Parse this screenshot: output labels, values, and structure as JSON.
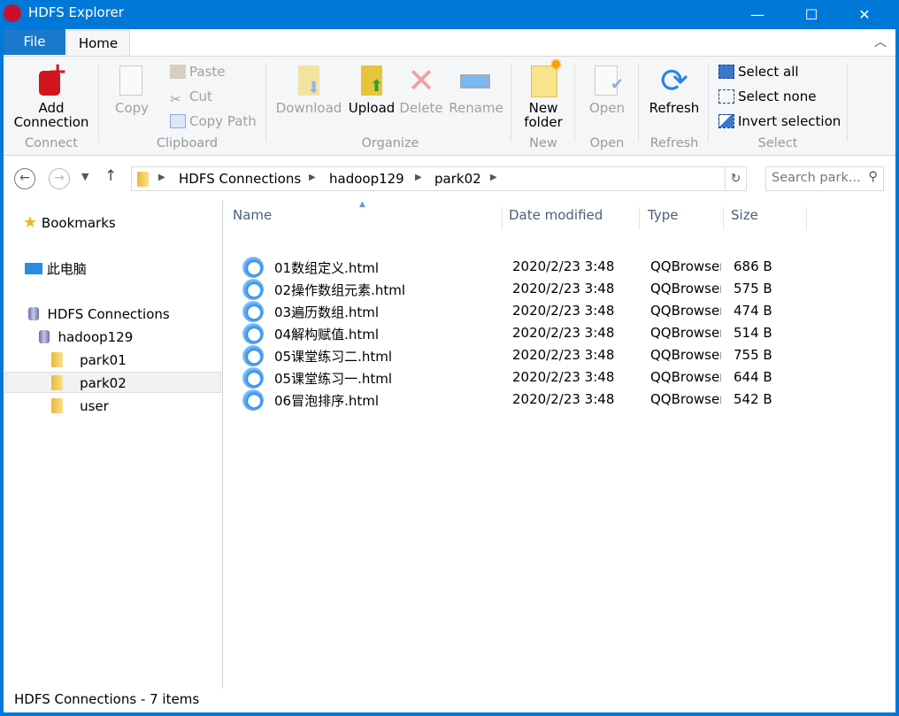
{
  "window": {
    "title": "HDFS Explorer",
    "minimize": "—",
    "maximize": "☐",
    "close": "✕"
  },
  "ribbon": {
    "tabs": {
      "file": "File",
      "home": "Home"
    },
    "connect": {
      "add_connection_1": "Add",
      "add_connection_2": "Connection",
      "label": "Connect"
    },
    "clipboard": {
      "copy": "Copy",
      "paste": "Paste",
      "cut": "Cut",
      "copy_path": "Copy Path",
      "label": "Clipboard"
    },
    "organize": {
      "download": "Download",
      "upload": "Upload",
      "delete": "Delete",
      "rename": "Rename",
      "label": "Organize"
    },
    "new": {
      "new_folder_1": "New",
      "new_folder_2": "folder",
      "label": "New"
    },
    "open": {
      "open": "Open",
      "label": "Open"
    },
    "refresh": {
      "refresh": "Refresh",
      "label": "Refresh"
    },
    "select": {
      "select_all": "Select all",
      "select_none": "Select none",
      "invert": "Invert selection",
      "label": "Select"
    }
  },
  "address": {
    "crumbs": [
      "HDFS Connections",
      "hadoop129",
      "park02"
    ],
    "search_placeholder": "Search park..."
  },
  "sidebar": {
    "bookmarks": "Bookmarks",
    "this_pc": "此电脑",
    "hdfs": "HDFS Connections",
    "host": "hadoop129",
    "folders": [
      "park01",
      "park02",
      "user"
    ],
    "selected": "park02"
  },
  "files": {
    "columns": [
      "Name",
      "Date modified",
      "Type",
      "Size"
    ],
    "rows": [
      {
        "name": "01数组定义.html",
        "date": "2020/2/23 3:48",
        "type": "QQBrowser",
        "size": "686 B"
      },
      {
        "name": "02操作数组元素.html",
        "date": "2020/2/23 3:48",
        "type": "QQBrowser",
        "size": "575 B"
      },
      {
        "name": "03遍历数组.html",
        "date": "2020/2/23 3:48",
        "type": "QQBrowser",
        "size": "474 B"
      },
      {
        "name": "04解构赋值.html",
        "date": "2020/2/23 3:48",
        "type": "QQBrowser",
        "size": "514 B"
      },
      {
        "name": "05课堂练习二.html",
        "date": "2020/2/23 3:48",
        "type": "QQBrowser",
        "size": "755 B"
      },
      {
        "name": "05课堂练习一.html",
        "date": "2020/2/23 3:48",
        "type": "QQBrowser",
        "size": "644 B"
      },
      {
        "name": "06冒泡排序.html",
        "date": "2020/2/23 3:48",
        "type": "QQBrowser",
        "size": "542 B"
      }
    ]
  },
  "status": "HDFS Connections - 7 items",
  "colors": {
    "titlebar": "#0078d7",
    "file_tab": "#1979ca",
    "ribbon": "#f5f6f7"
  }
}
